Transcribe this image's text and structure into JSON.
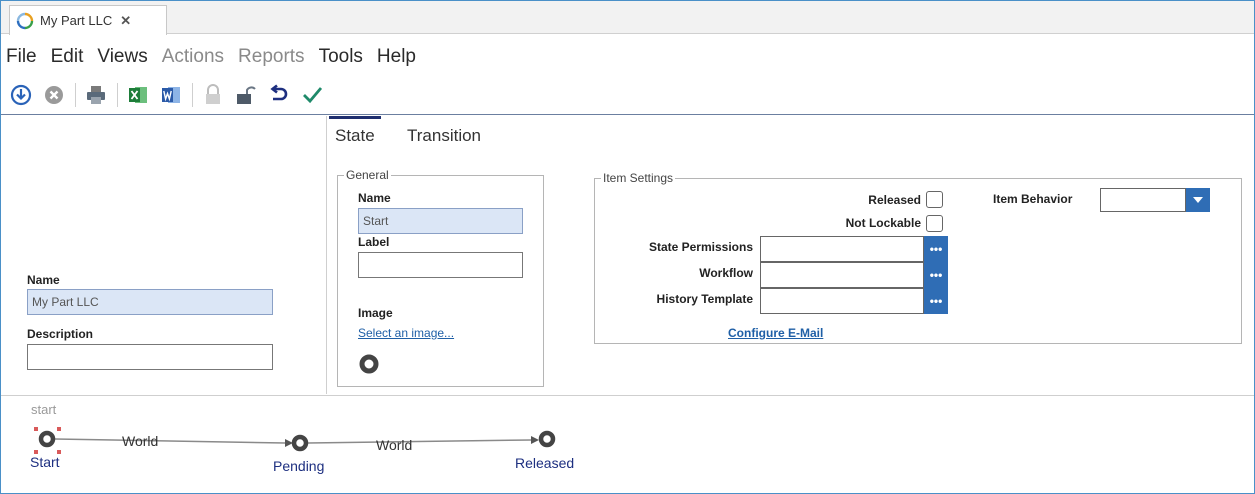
{
  "tab": {
    "title": "My Part LLC",
    "close": "✕"
  },
  "menu": {
    "file": "File",
    "edit": "Edit",
    "views": "Views",
    "actions": "Actions",
    "reports": "Reports",
    "tools": "Tools",
    "help": "Help"
  },
  "left": {
    "name_label": "Name",
    "name_value": "My Part LLC",
    "description_label": "Description",
    "description_value": ""
  },
  "tabs": {
    "state": "State",
    "transition": "Transition"
  },
  "general": {
    "legend": "General",
    "name_label": "Name",
    "name_value": "Start",
    "label_label": "Label",
    "label_value": "",
    "image_label": "Image",
    "select_image_link": "Select an image..."
  },
  "item_settings": {
    "legend": "Item Settings",
    "released_label": "Released",
    "not_lockable_label": "Not Lockable",
    "item_behavior_label": "Item Behavior",
    "item_behavior_value": "",
    "state_permissions_label": "State Permissions",
    "workflow_label": "Workflow",
    "history_template_label": "History Template",
    "picker_button": "•••",
    "configure_email_link": "Configure E-Mail"
  },
  "diagram": {
    "start_tag": "start",
    "node_start": "Start",
    "node_pending": "Pending",
    "node_released": "Released",
    "edge_1": "World",
    "edge_2": "World"
  }
}
